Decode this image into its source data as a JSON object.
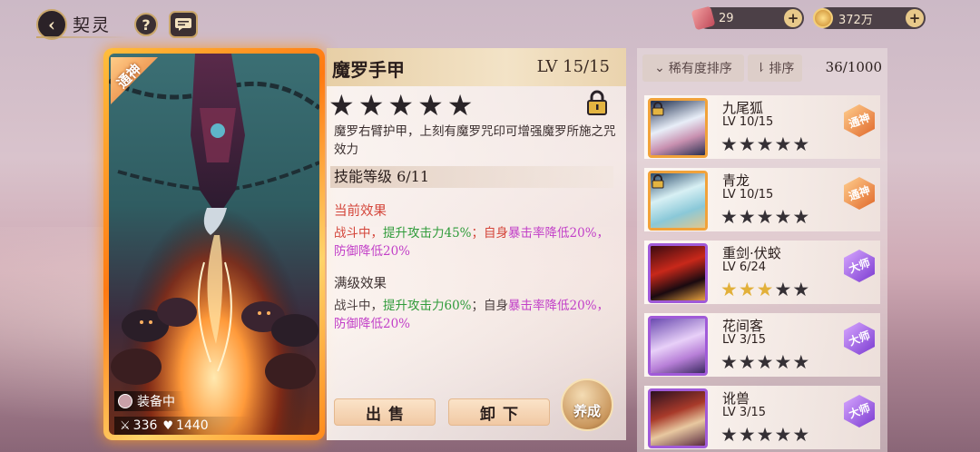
{
  "header": {
    "title": "契灵"
  },
  "currencies": [
    {
      "icon": "ticket-icon",
      "value": "29"
    },
    {
      "icon": "gold-coin-icon",
      "value": "372万"
    }
  ],
  "card": {
    "rank_badge": "通神",
    "equip_status": "装备中",
    "attack": "336",
    "health": "1440"
  },
  "detail": {
    "name": "魔罗手甲",
    "level": "LV 15/15",
    "stars_total": 5,
    "stars_filled": 0,
    "description": "魔罗右臂护甲，上刻有魔罗咒印可增强魔罗所施之咒效力",
    "skill_level": "技能等级 6/11",
    "current_effect_title": "当前效果",
    "current_effect": {
      "prefix": "战斗中，",
      "buff": "提升攻击力45%",
      "sep": "；自身",
      "debuff": "暴击率降低20%，防御降低20%"
    },
    "max_effect_title": "满级效果",
    "max_effect": {
      "prefix": "战斗中，",
      "buff": "提升攻击力60%",
      "sep": "；自身",
      "debuff": "暴击率降低20%，防御降低20%"
    },
    "sell_label": "出售",
    "unequip_label": "卸下",
    "cultivate_label": "养成"
  },
  "list": {
    "sort_rarity_label": "稀有度排序",
    "sort_order_label": "排序",
    "count": "36/1000",
    "items": [
      {
        "name": "九尾狐",
        "level": "LV 10/15",
        "stars": 0,
        "badge": "通神",
        "badge_type": "tongshen",
        "frame": "gold",
        "locked": true
      },
      {
        "name": "青龙",
        "level": "LV 10/15",
        "stars": 0,
        "badge": "通神",
        "badge_type": "tongshen",
        "frame": "gold",
        "locked": true
      },
      {
        "name": "重剑·伏蛟",
        "level": "LV 6/24",
        "stars": 3,
        "badge": "大师",
        "badge_type": "dashi",
        "frame": "purple",
        "locked": false
      },
      {
        "name": "花间客",
        "level": "LV 3/15",
        "stars": 0,
        "badge": "大师",
        "badge_type": "dashi",
        "frame": "purple",
        "locked": false
      },
      {
        "name": "讹兽",
        "level": "LV 3/15",
        "stars": 0,
        "badge": "大师",
        "badge_type": "dashi",
        "frame": "purple",
        "locked": false
      }
    ]
  },
  "colors": {
    "accent_gold": "#c9a66b",
    "card_glow": "#ff8a1a",
    "effect_red": "#d4453a",
    "buff_green": "#2f9b3a",
    "debuff_purple": "#c240c8"
  }
}
